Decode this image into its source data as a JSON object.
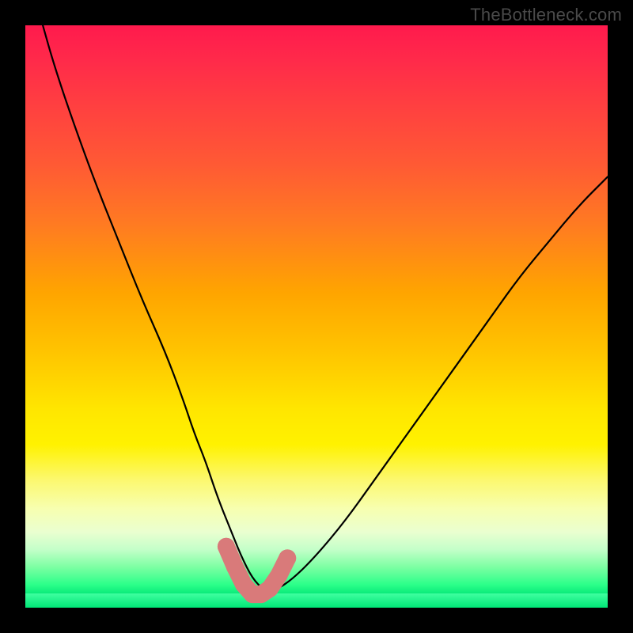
{
  "watermark": "TheBottleneck.com",
  "chart_data": {
    "type": "line",
    "title": "",
    "xlabel": "",
    "ylabel": "",
    "xlim": [
      0,
      100
    ],
    "ylim": [
      0,
      100
    ],
    "series": [
      {
        "name": "bottleneck-curve",
        "x": [
          3,
          5,
          8,
          12,
          16,
          20,
          24,
          27,
          29,
          31,
          33,
          35,
          37,
          39,
          41,
          43,
          46,
          50,
          55,
          60,
          65,
          70,
          75,
          80,
          85,
          90,
          95,
          100
        ],
        "values": [
          100,
          93,
          84,
          73,
          63,
          53,
          44,
          36,
          30,
          25,
          19,
          14,
          9,
          5,
          3,
          3,
          5,
          9,
          15,
          22,
          29,
          36,
          43,
          50,
          57,
          63,
          69,
          74
        ]
      }
    ],
    "highlight": {
      "name": "optimal-range-markers",
      "x": [
        34.5,
        36.0,
        37.5,
        39.0,
        40.5,
        42.0,
        43.5,
        45.0
      ],
      "values": [
        10.5,
        7.0,
        4.0,
        2.3,
        2.3,
        3.3,
        5.5,
        8.5
      ]
    }
  },
  "colors": {
    "curve": "#000000",
    "marker": "#d97a7a",
    "background_top": "#ff1a4d",
    "background_bottom": "#00e676"
  }
}
